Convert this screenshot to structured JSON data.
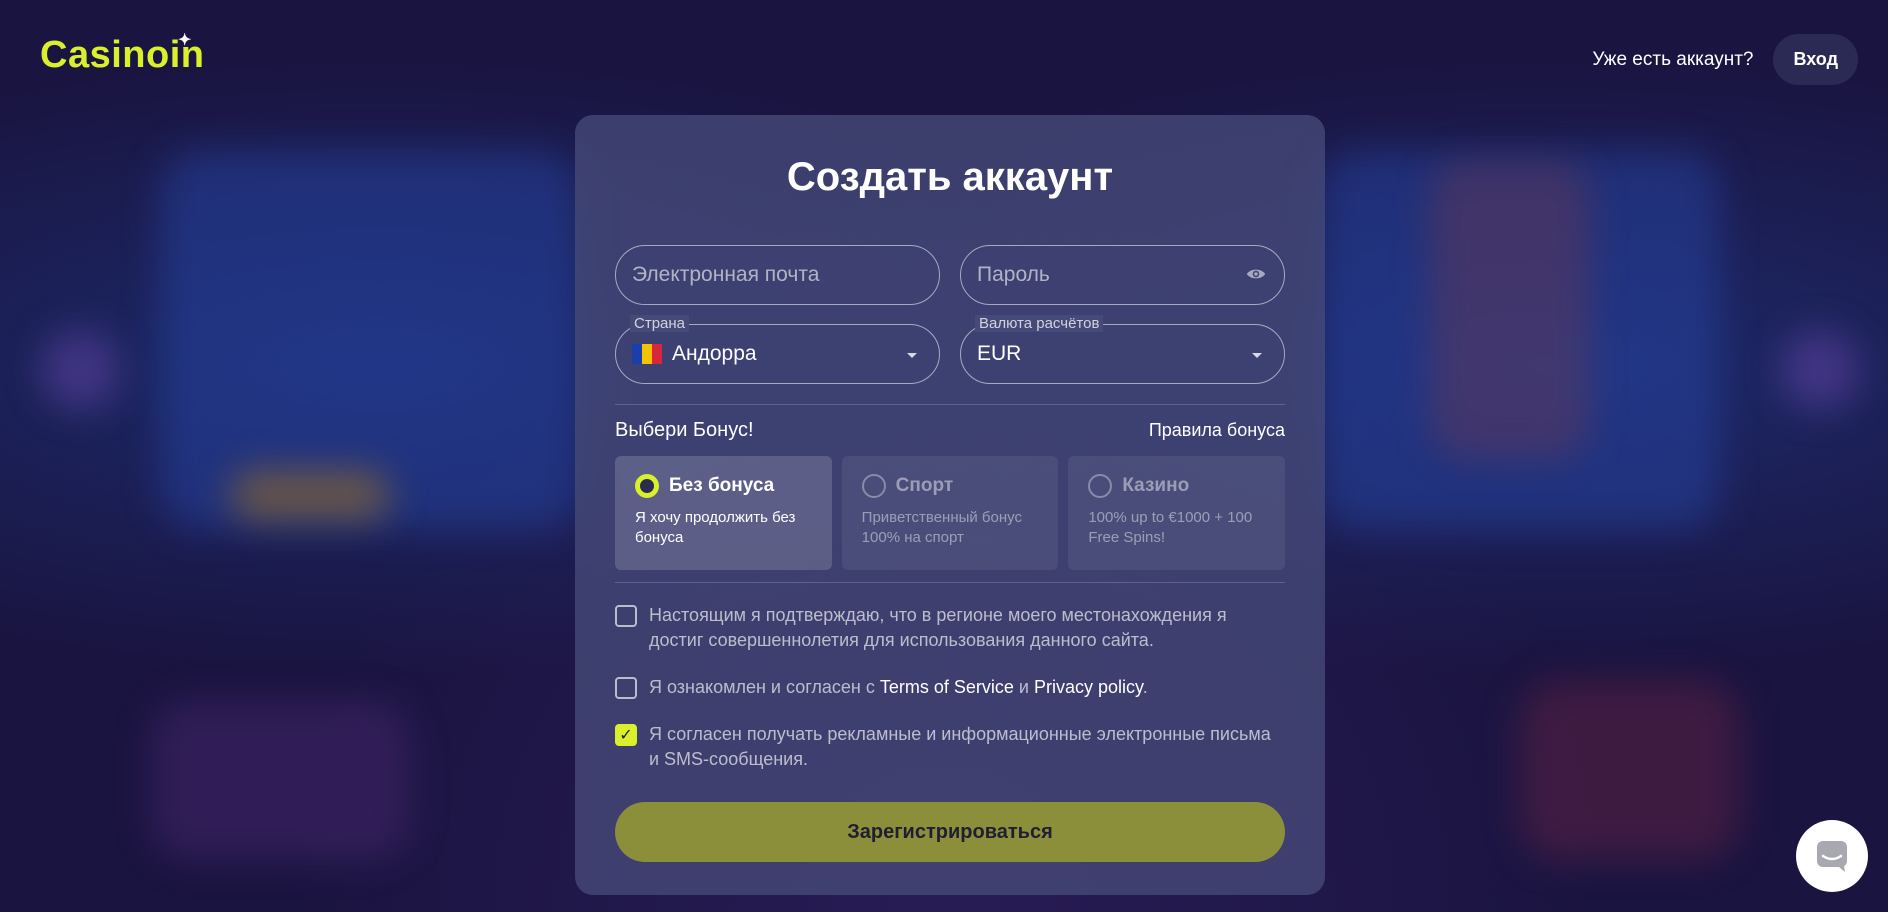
{
  "header": {
    "logo": "Casinoin",
    "have_account": "Уже есть аккаунт?",
    "login_label": "Вход"
  },
  "form": {
    "title": "Создать аккаунт",
    "email_placeholder": "Электронная почта",
    "password_placeholder": "Пароль",
    "country_label": "Страна",
    "country_value": "Андорра",
    "currency_label": "Валюта расчётов",
    "currency_value": "EUR",
    "bonus_title": "Выбери Бонус!",
    "bonus_rules": "Правила бонуса",
    "bonuses": [
      {
        "title": "Без бонуса",
        "desc": "Я хочу продолжить без бонуса",
        "selected": true
      },
      {
        "title": "Спорт",
        "desc": "Приветственный бонус 100% на спорт",
        "selected": false
      },
      {
        "title": "Казино",
        "desc": "100% up to €1000 + 100 Free Spins!",
        "selected": false
      }
    ],
    "consent_age": "Настоящим я подтверждаю, что в регионе моего местонахождения я достиг совершеннолетия для использования данного сайта.",
    "consent_terms_prefix": "Я ознакомлен и согласен с",
    "terms_link": "Terms of Service",
    "consent_terms_and": "и",
    "privacy_link": "Privacy policy",
    "consent_terms_suffix": ".",
    "consent_marketing": "Я согласен получать рекламные и информационные электронные письма и SMS-сообщения.",
    "register_label": "Зарегистрироваться"
  },
  "colors": {
    "accent": "#d9f02a",
    "background": "#1a1440",
    "card": "#454a78"
  }
}
